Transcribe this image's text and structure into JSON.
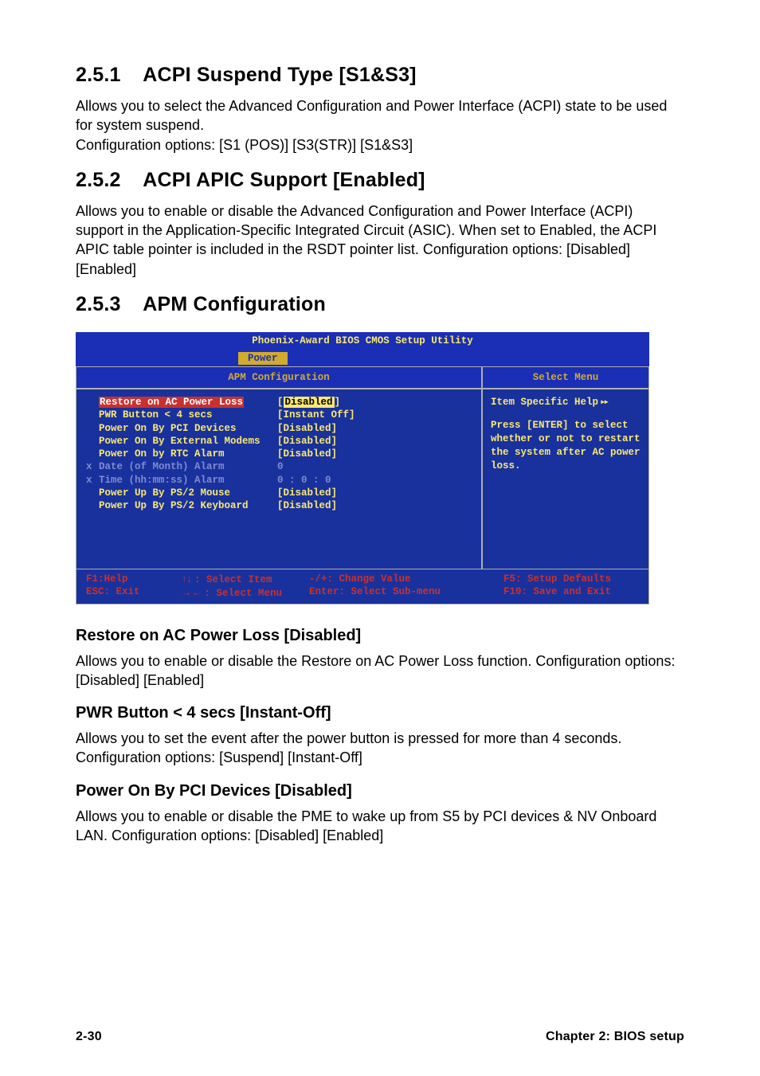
{
  "section_251": {
    "heading_num": "2.5.1",
    "heading_text": "ACPI Suspend Type [S1&S3]",
    "body": "Allows you to select the Advanced Configuration and Power Interface (ACPI) state to be used for system suspend.\nConfiguration options: [S1 (POS)] [S3(STR)] [S1&S3]"
  },
  "section_252": {
    "heading_num": "2.5.2",
    "heading_text": "ACPI APIC Support [Enabled]",
    "body": "Allows you to enable or disable the Advanced Configuration and Power Interface (ACPI) support in the Application-Specific Integrated Circuit (ASIC). When set to Enabled, the ACPI APIC table pointer is included in the RSDT pointer list. Configuration options: [Disabled] [Enabled]"
  },
  "section_253": {
    "heading_num": "2.5.3",
    "heading_text": "APM Configuration"
  },
  "bios": {
    "title": "Phoenix-Award BIOS CMOS Setup Utility",
    "tab": "Power",
    "left_title": "APM Configuration",
    "right_title": "Select Menu",
    "items": [
      {
        "pre": "",
        "label": "Restore on AC Power Loss",
        "value": "Disabled",
        "selected": true,
        "greyed": false
      },
      {
        "pre": "",
        "label": "PWR Button < 4 secs",
        "value": "[Instant Off]",
        "selected": false,
        "greyed": false
      },
      {
        "pre": "",
        "label": "Power On By PCI Devices",
        "value": "[Disabled]",
        "selected": false,
        "greyed": false
      },
      {
        "pre": "",
        "label": "Power On By External Modems",
        "value": "[Disabled]",
        "selected": false,
        "greyed": false
      },
      {
        "pre": "",
        "label": "Power On by RTC Alarm",
        "value": "[Disabled]",
        "selected": false,
        "greyed": false
      },
      {
        "pre": "x",
        "label": "Date (of Month) Alarm",
        "value": " 0",
        "selected": false,
        "greyed": true
      },
      {
        "pre": "x",
        "label": "Time (hh:mm:ss) Alarm",
        "value": " 0 :   0 : 0",
        "selected": false,
        "greyed": true
      },
      {
        "pre": "",
        "label": "Power Up By PS/2 Mouse",
        "value": "[Disabled]",
        "selected": false,
        "greyed": false
      },
      {
        "pre": "",
        "label": "Power Up By PS/2 Keyboard",
        "value": "[Disabled]",
        "selected": false,
        "greyed": false
      }
    ],
    "help": {
      "title": "Item Specific Help",
      "body": "Press [ENTER] to select whether or not to restart the system after AC power loss."
    },
    "footer": {
      "f1": "F1:Help",
      "esc": "ESC: Exit",
      "select_item": ": Select Item",
      "select_menu": ": Select Menu",
      "change_value": "-/+: Change Value",
      "enter_sub": "Enter: Select Sub-menu",
      "f5": "F5: Setup Defaults",
      "f10": "F10: Save and Exit"
    }
  },
  "restore": {
    "heading": "Restore on AC Power Loss [Disabled]",
    "body": "Allows you to enable or disable the Restore on AC Power Loss function. Configuration options: [Disabled] [Enabled]"
  },
  "pwr": {
    "heading": "PWR Button < 4 secs [Instant-Off]",
    "body": "Allows you to set the event after the power button is pressed for more than 4 seconds. Configuration options: [Suspend] [Instant-Off]"
  },
  "pci": {
    "heading": "Power On By PCI Devices [Disabled]",
    "body": "Allows you to enable or disable the PME to wake up from S5 by PCI devices & NV Onboard LAN. Configuration options: [Disabled] [Enabled]"
  },
  "footer": {
    "page": "2-30",
    "chapter": "Chapter 2: BIOS setup"
  }
}
